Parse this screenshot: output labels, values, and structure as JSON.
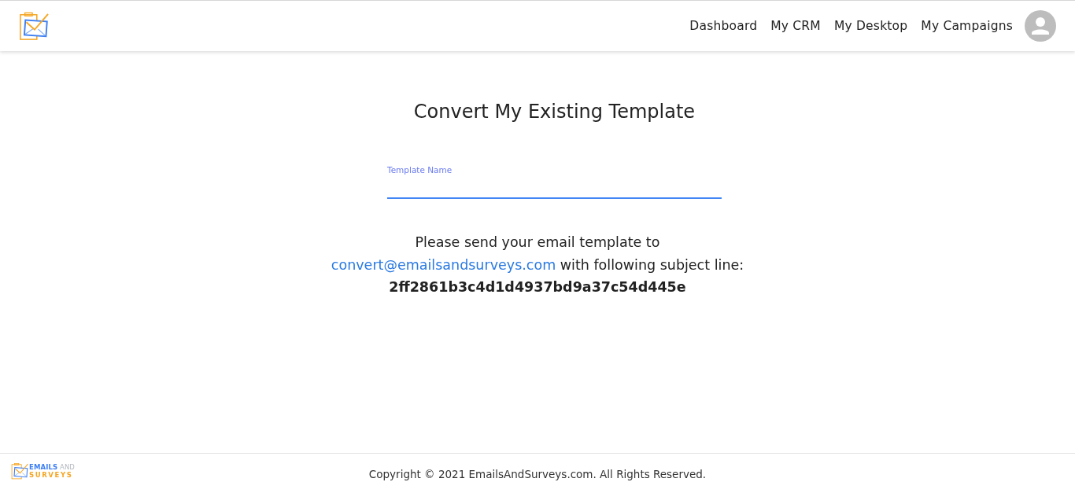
{
  "header": {
    "nav": [
      {
        "label": "Dashboard"
      },
      {
        "label": "My CRM"
      },
      {
        "label": "My Desktop"
      },
      {
        "label": "My Campaigns"
      }
    ]
  },
  "main": {
    "title": "Convert My Existing Template",
    "field": {
      "label": "Template Name",
      "focused": true
    },
    "message": {
      "intro": "Please send your email template to",
      "email": "convert@emailsandsurveys.com",
      "subject_prompt": "with following subject line:",
      "subject_code": "2ff2861b3c4d1d4937bd9a37c54d445e"
    }
  },
  "footer": {
    "logo": {
      "word_1": "EMAILS",
      "word_2": "AND",
      "word_3": "SURVEYS"
    },
    "copyright": "Copyright © 2021 EmailsAndSurveys.com. All Rights Reserved."
  }
}
